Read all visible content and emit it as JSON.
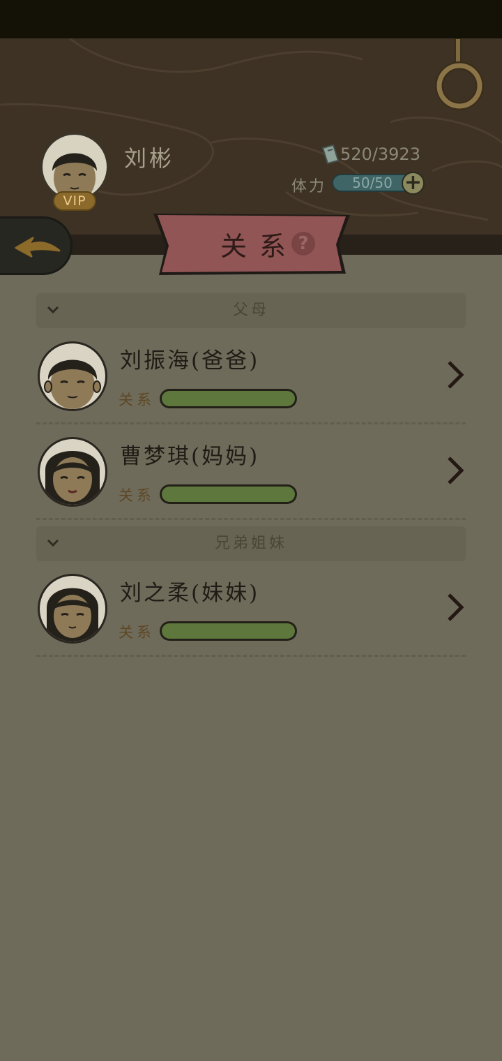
{
  "player": {
    "name": "刘彬",
    "vip_label": "VIP",
    "money": "520/3923",
    "stamina_label": "体力",
    "stamina_value": "50/50",
    "stamina_plus": "+"
  },
  "banner": {
    "title": "关系",
    "help": "?"
  },
  "sections": [
    {
      "title": "父母",
      "members": [
        {
          "name": "刘振海(爸爸)",
          "relation_label": "关系",
          "relation_level": 1.0
        },
        {
          "name": "曹梦琪(妈妈)",
          "relation_label": "关系",
          "relation_level": 1.0
        }
      ]
    },
    {
      "title": "兄弟姐妹",
      "members": [
        {
          "name": "刘之柔(妹妹)",
          "relation_label": "关系",
          "relation_level": 1.0
        }
      ]
    }
  ],
  "icons": {
    "back": "back-arrow-icon",
    "ring": "ring-icon",
    "ticket": "ticket-icon",
    "chevron_down": "chevron-down-icon",
    "chevron_right": "chevron-right-icon",
    "help": "help-icon"
  },
  "colors": {
    "header_bg": "#3e3225",
    "content_bg": "#6f6b5b",
    "banner": "#925555",
    "relation_bar": "#5d773d",
    "stamina_bar": "#3f6566"
  }
}
